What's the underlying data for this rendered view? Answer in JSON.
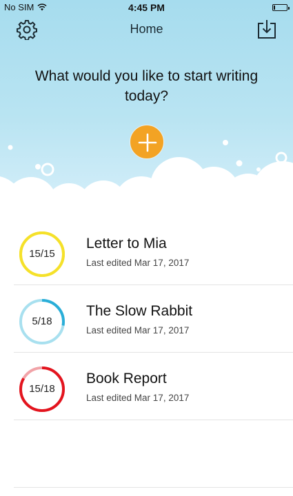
{
  "status_bar": {
    "carrier": "No SIM",
    "time": "4:45 PM"
  },
  "nav": {
    "title": "Home"
  },
  "hero": {
    "prompt": "What would you like to start writing today?"
  },
  "colors": {
    "accent": "#f3a324",
    "sky": "#a6dcee",
    "ring_complete": "#f5e12a",
    "ring_blue": "#2aaed8",
    "ring_red": "#e3141e"
  },
  "documents": [
    {
      "title": "Letter to Mia",
      "progress_label": "15/15",
      "done": 15,
      "total": 15,
      "edited": "Last edited Mar 17, 2017",
      "ring_color": "#f5e12a",
      "track_color": "#f5e12a"
    },
    {
      "title": "The Slow Rabbit",
      "progress_label": "5/18",
      "done": 5,
      "total": 18,
      "edited": "Last edited Mar 17, 2017",
      "ring_color": "#2aaed8",
      "track_color": "#a8e0ef"
    },
    {
      "title": "Book Report",
      "progress_label": "15/18",
      "done": 15,
      "total": 18,
      "edited": "Last edited Mar 17, 2017",
      "ring_color": "#e3141e",
      "track_color": "#f1a3a8"
    }
  ]
}
